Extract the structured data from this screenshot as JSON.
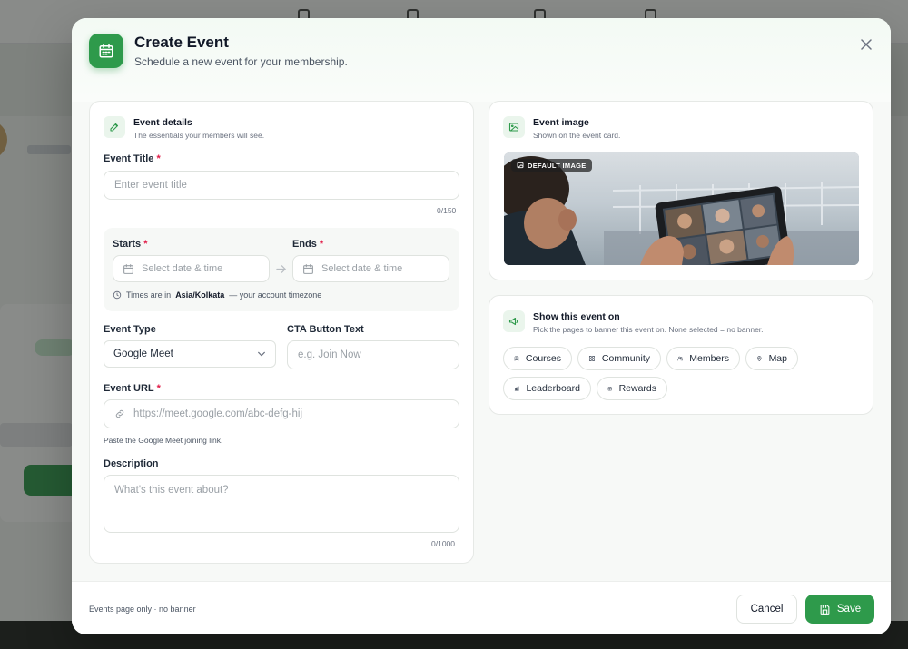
{
  "modal": {
    "title": "Create Event",
    "subtitle": "Schedule a new event for your membership."
  },
  "event_details": {
    "section_title": "Event details",
    "section_subtitle": "The essentials your members will see.",
    "title_label": "Event Title",
    "title_placeholder": "Enter event title",
    "title_counter": "0/150",
    "starts_label": "Starts",
    "ends_label": "Ends",
    "date_placeholder": "Select date & time",
    "tz_prefix": "Times are in",
    "tz_value": "Asia/Kolkata",
    "tz_suffix": "— your account timezone",
    "type_label": "Event Type",
    "type_value": "Google Meet",
    "cta_label": "CTA Button Text",
    "cta_placeholder": "e.g. Join Now",
    "url_label": "Event URL",
    "url_placeholder": "https://meet.google.com/abc-defg-hij",
    "url_hint": "Paste the Google Meet joining link.",
    "description_label": "Description",
    "description_placeholder": "What's this event about?",
    "description_counter": "0/1000"
  },
  "event_image": {
    "section_title": "Event image",
    "section_subtitle": "Shown on the event card.",
    "badge": "DEFAULT IMAGE"
  },
  "show_on": {
    "section_title": "Show this event on",
    "section_subtitle": "Pick the pages to banner this event on. None selected = no banner.",
    "pages": [
      "Courses",
      "Community",
      "Members",
      "Map",
      "Leaderboard",
      "Rewards"
    ]
  },
  "footer": {
    "status": "Events page only · no banner",
    "cancel_label": "Cancel",
    "save_label": "Save"
  },
  "colors": {
    "primary": "#2e9a4b",
    "required": "#e11d48"
  }
}
